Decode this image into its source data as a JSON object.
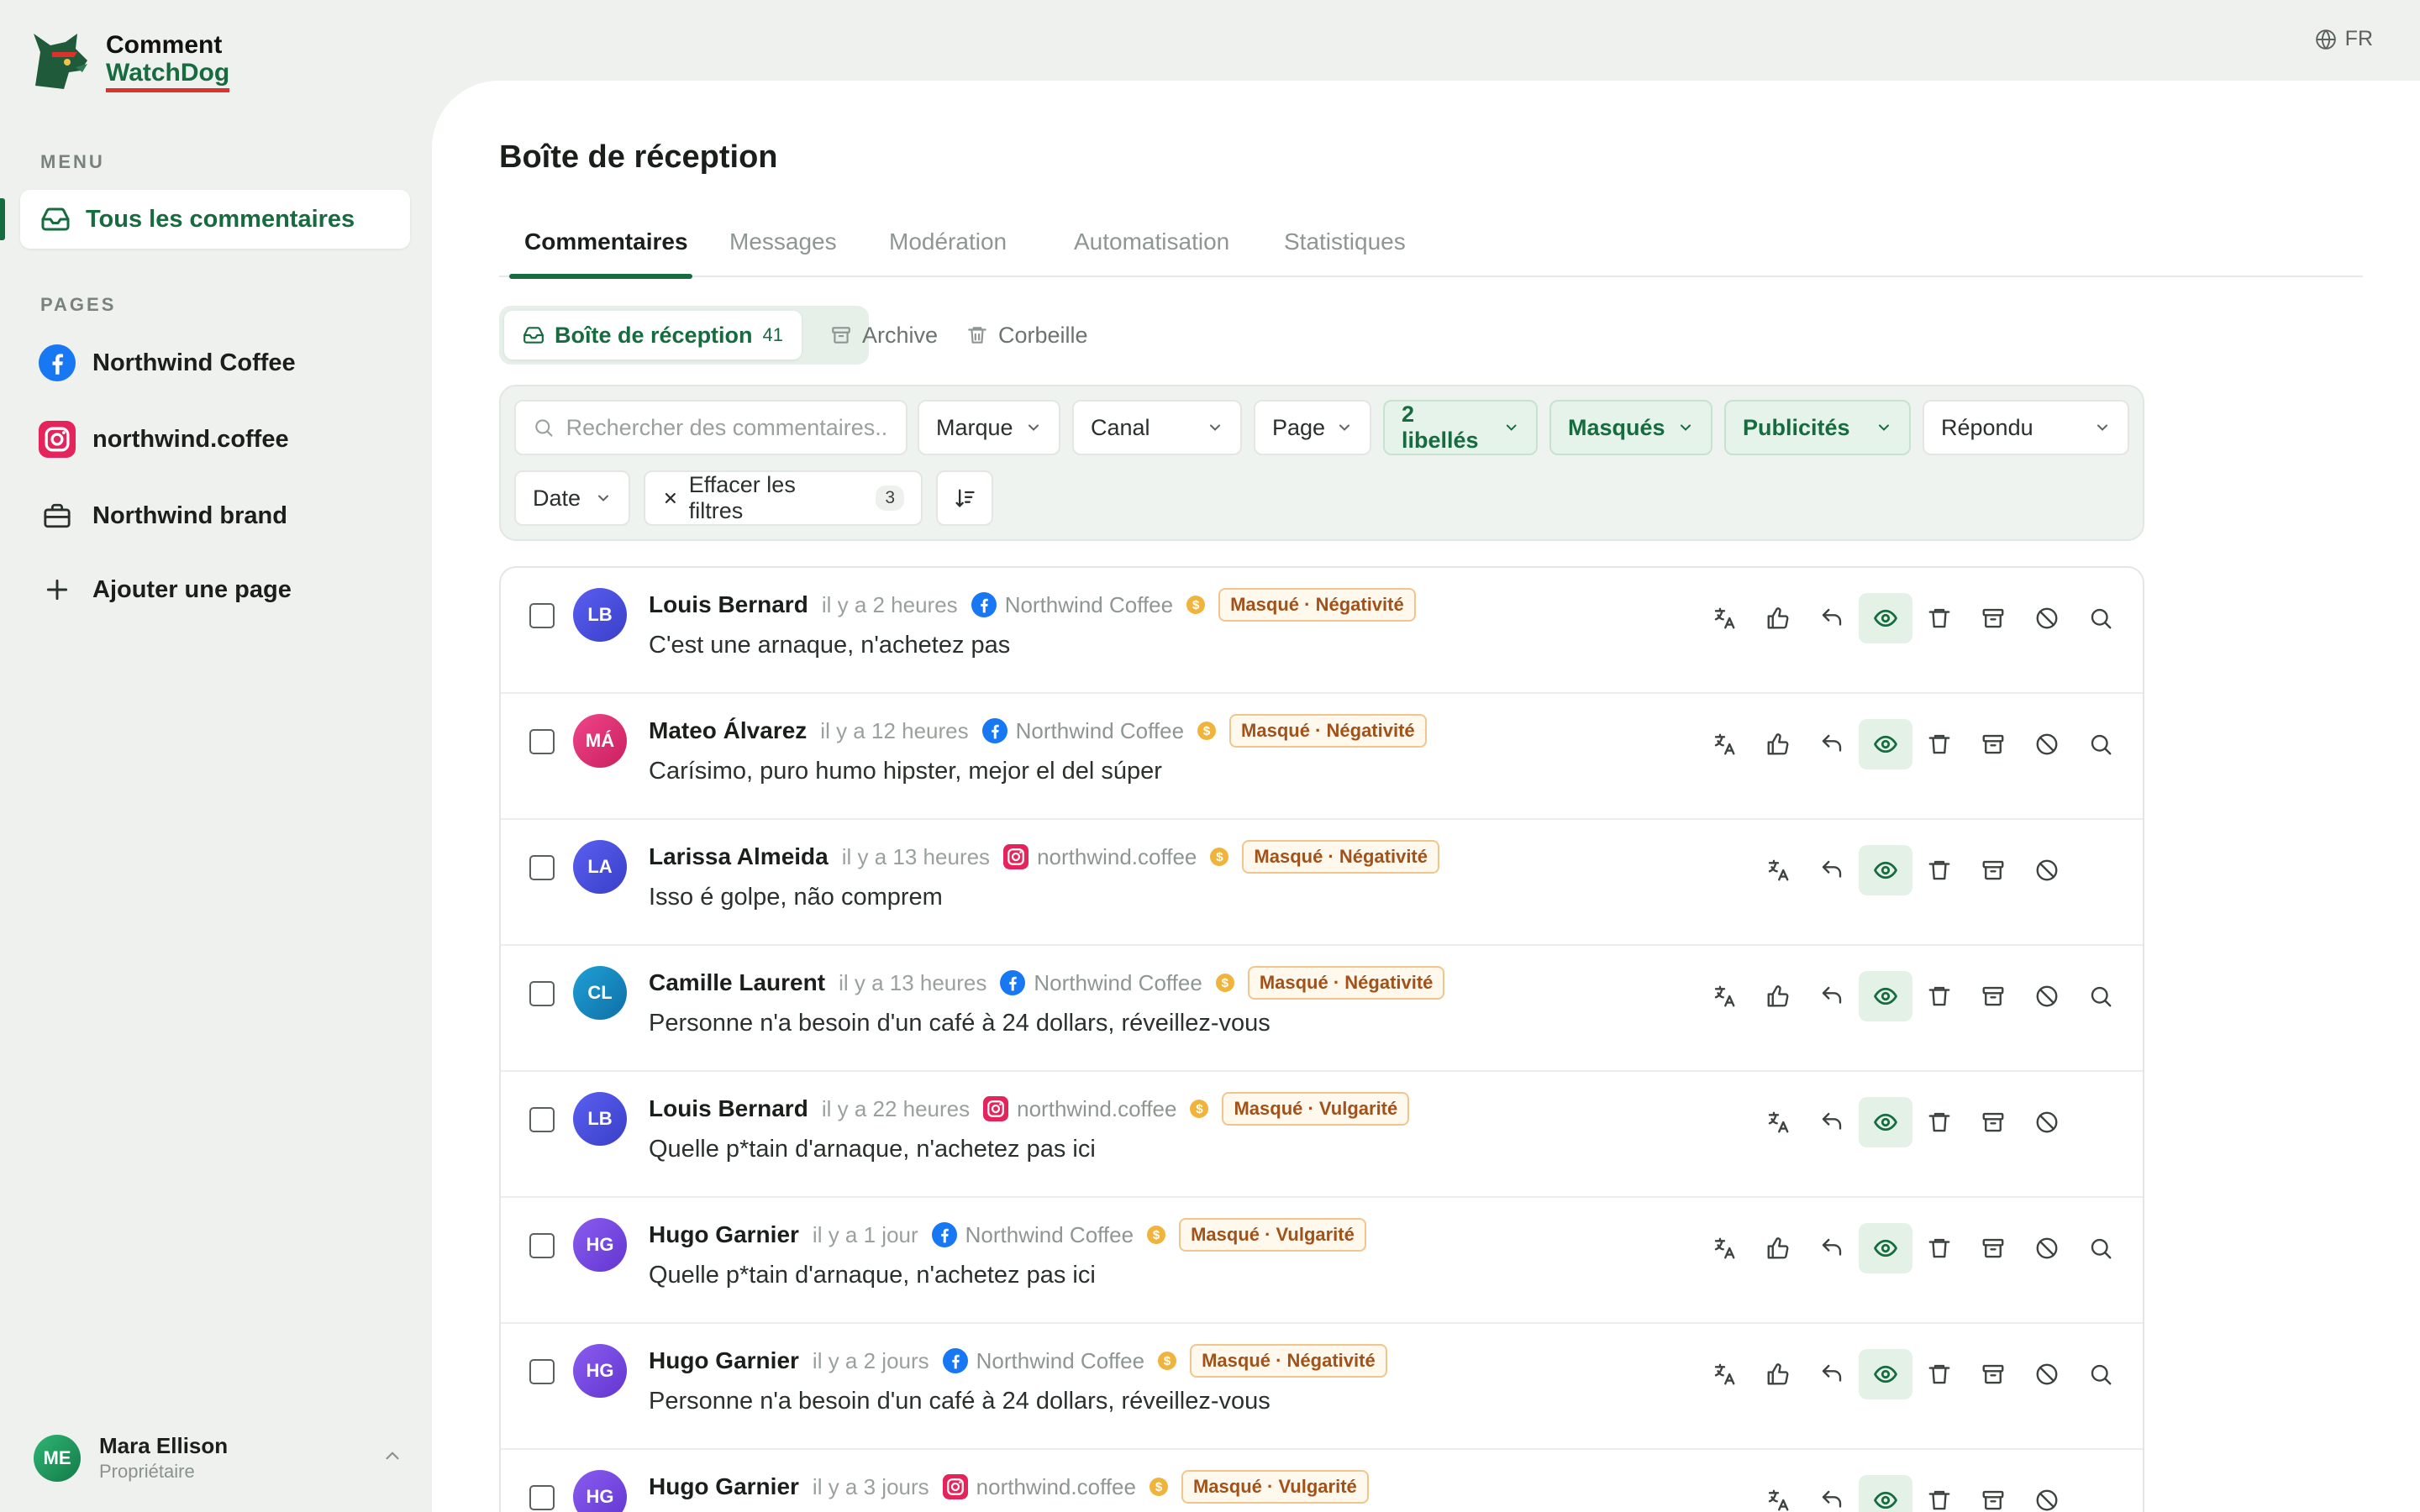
{
  "brand": {
    "line1": "Comment",
    "line2": "WatchDog"
  },
  "language": "FR",
  "sidebar": {
    "menu_label": "MENU",
    "all_comments": "Tous les commentaires",
    "pages_label": "PAGES",
    "pages": [
      {
        "label": "Northwind Coffee",
        "icon": "facebook-icon"
      },
      {
        "label": "northwind.coffee",
        "icon": "instagram-icon"
      },
      {
        "label": "Northwind brand",
        "icon": "briefcase-icon"
      }
    ],
    "add_page": "Ajouter une page",
    "user": {
      "initials": "ME",
      "name": "Mara Ellison",
      "role": "Propriétaire"
    }
  },
  "main": {
    "title": "Boîte de réception",
    "tabs": [
      "Commentaires",
      "Messages",
      "Modération",
      "Automatisation",
      "Statistiques"
    ],
    "segments": [
      {
        "label": "Boîte de réception",
        "count": "41"
      },
      {
        "label": "Archive"
      },
      {
        "label": "Corbeille"
      }
    ],
    "filters": {
      "search_placeholder": "Rechercher des commentaires...",
      "brand": "Marque",
      "channel": "Canal",
      "page": "Page",
      "labels": "2 libellés",
      "hidden": "Masqués",
      "ads": "Publicités",
      "replied": "Répondu",
      "date": "Date",
      "clear": "Effacer les filtres",
      "clear_count": "3"
    },
    "comments": [
      {
        "initials": "LB",
        "name": "Louis Bernard",
        "time": "il y a 2 heures",
        "page": "Northwind Coffee",
        "platform": "facebook",
        "tag": "Masqué · Négativité",
        "text": "C'est une arnaque, n'achetez pas"
      },
      {
        "initials": "MÁ",
        "name": "Mateo Álvarez",
        "time": "il y a 12 heures",
        "page": "Northwind Coffee",
        "platform": "facebook",
        "tag": "Masqué · Négativité",
        "text": "Carísimo, puro humo hipster, mejor el del súper"
      },
      {
        "initials": "LA",
        "name": "Larissa Almeida",
        "time": "il y a 13 heures",
        "page": "northwind.coffee",
        "platform": "instagram",
        "tag": "Masqué · Négativité",
        "text": "Isso é golpe, não comprem"
      },
      {
        "initials": "CL",
        "name": "Camille Laurent",
        "time": "il y a 13 heures",
        "page": "Northwind Coffee",
        "platform": "facebook",
        "tag": "Masqué · Négativité",
        "text": "Personne n'a besoin d'un café à 24 dollars, réveillez-vous"
      },
      {
        "initials": "LB",
        "name": "Louis Bernard",
        "time": "il y a 22 heures",
        "page": "northwind.coffee",
        "platform": "instagram",
        "tag": "Masqué · Vulgarité",
        "text": "Quelle p*tain d'arnaque, n'achetez pas ici"
      },
      {
        "initials": "HG",
        "name": "Hugo Garnier",
        "time": "il y a 1 jour",
        "page": "Northwind Coffee",
        "platform": "facebook",
        "tag": "Masqué · Vulgarité",
        "text": "Quelle p*tain d'arnaque, n'achetez pas ici"
      },
      {
        "initials": "HG",
        "name": "Hugo Garnier",
        "time": "il y a 2 jours",
        "page": "Northwind Coffee",
        "platform": "facebook",
        "tag": "Masqué · Négativité",
        "text": "Personne n'a besoin d'un café à 24 dollars, réveillez-vous"
      },
      {
        "initials": "HG",
        "name": "Hugo Garnier",
        "time": "il y a 3 jours",
        "page": "northwind.coffee",
        "platform": "instagram",
        "tag": "Masqué · Vulgarité",
        "text": ""
      }
    ]
  }
}
